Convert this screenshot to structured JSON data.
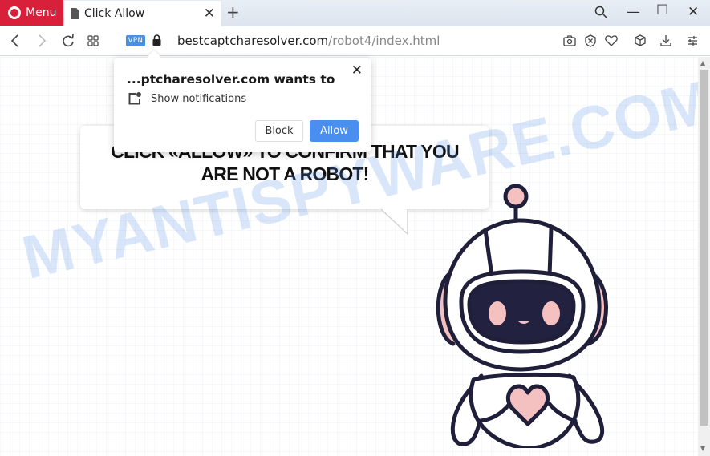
{
  "browser": {
    "menu_label": "Menu",
    "tab": {
      "title": "Click Allow",
      "close": "✕"
    },
    "new_tab": "+",
    "window_controls": {
      "search": "search-icon",
      "minimize": "—",
      "maximize": "☐",
      "close": "✕"
    },
    "address": {
      "vpn_badge": "VPN",
      "domain": "bestcaptcharesolver.com",
      "path": "/robot4/index.html"
    },
    "nav": {
      "back": "‹",
      "forward": "›",
      "reload": "↻",
      "speed_dial": "speed-dial-icon"
    },
    "toolbar_icons": [
      "camera-icon",
      "shield-x-icon",
      "heart-icon",
      "cube-icon",
      "download-icon",
      "settings-sliders-icon"
    ],
    "scrollbar": {
      "up": "▲",
      "down": "▼"
    }
  },
  "permission_popup": {
    "title": "...ptcharesolver.com wants to",
    "permission": "Show notifications",
    "close": "✕",
    "block_label": "Block",
    "allow_label": "Allow",
    "allow_color": "#4a8ff0"
  },
  "page": {
    "headline": "CLICK «ALLOW» TO CONFIRM THAT YOU ARE NOT A ROBOT!",
    "watermark": "MYANTISPYWARE.COM",
    "robot_colors": {
      "outline": "#1f1f3a",
      "accent": "#f5c0c0",
      "face": "#22213f"
    }
  }
}
